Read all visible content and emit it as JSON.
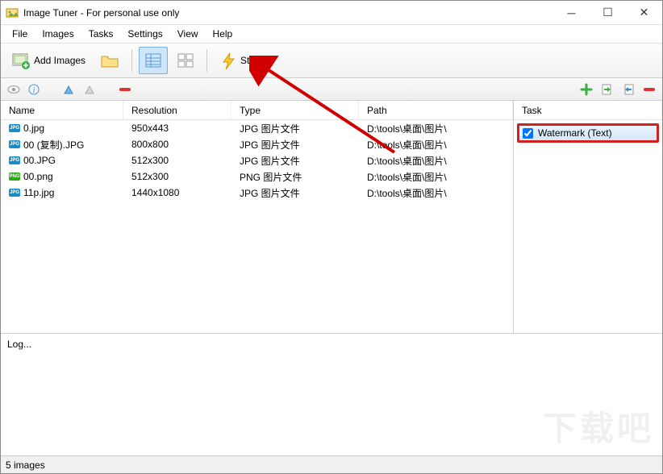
{
  "window": {
    "title": "Image Tuner - For personal use only"
  },
  "menu": {
    "items": [
      "File",
      "Images",
      "Tasks",
      "Settings",
      "View",
      "Help"
    ]
  },
  "toolbar": {
    "add_images": "Add Images",
    "start": "Start"
  },
  "columns": {
    "name": "Name",
    "resolution": "Resolution",
    "type": "Type",
    "path": "Path",
    "task": "Task"
  },
  "files": [
    {
      "icon": "jpg",
      "name": "0.jpg",
      "resolution": "950x443",
      "type": "JPG 图片文件",
      "path": "D:\\tools\\桌面\\图片\\"
    },
    {
      "icon": "jpg",
      "name": "00 (复制).JPG",
      "resolution": "800x800",
      "type": "JPG 图片文件",
      "path": "D:\\tools\\桌面\\图片\\"
    },
    {
      "icon": "jpg",
      "name": "00.JPG",
      "resolution": "512x300",
      "type": "JPG 图片文件",
      "path": "D:\\tools\\桌面\\图片\\"
    },
    {
      "icon": "png",
      "name": "00.png",
      "resolution": "512x300",
      "type": "PNG 图片文件",
      "path": "D:\\tools\\桌面\\图片\\"
    },
    {
      "icon": "jpg",
      "name": "11p.jpg",
      "resolution": "1440x1080",
      "type": "JPG 图片文件",
      "path": "D:\\tools\\桌面\\图片\\"
    }
  ],
  "tasks": [
    {
      "label": "Watermark (Text)",
      "checked": true
    }
  ],
  "log": {
    "label": "Log..."
  },
  "status": {
    "text": "5 images"
  },
  "watermark": "下载吧"
}
